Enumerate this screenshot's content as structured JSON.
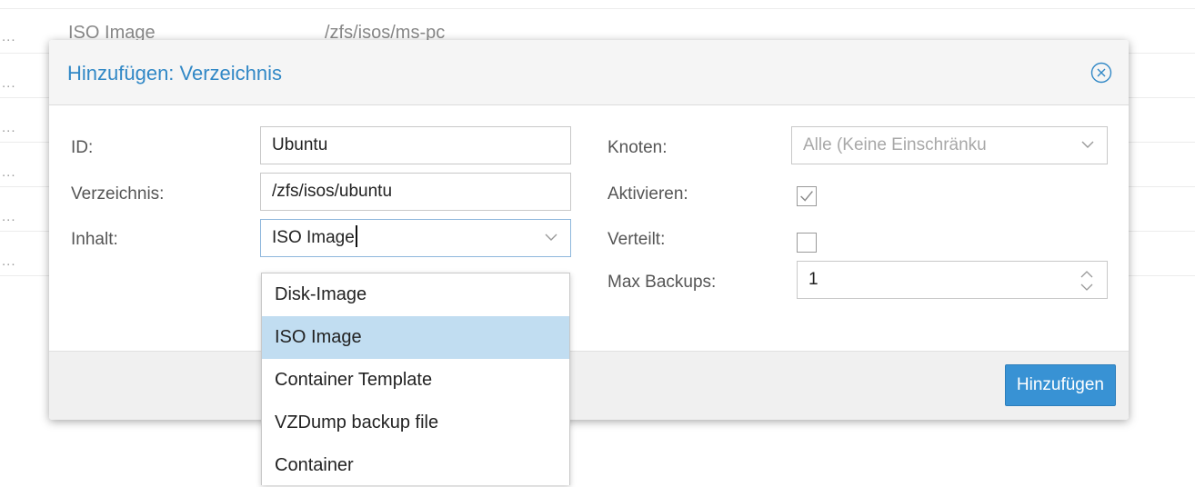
{
  "background": {
    "dots": "...",
    "visible_row": {
      "content": "ISO Image",
      "path": "/zfs/isos/ms-pc"
    }
  },
  "dialog": {
    "title": "Hinzufügen: Verzeichnis",
    "close_icon": "circle-x-icon",
    "fields": {
      "id": {
        "label": "ID:",
        "value": "Ubuntu"
      },
      "directory": {
        "label": "Verzeichnis:",
        "value": "/zfs/isos/ubuntu"
      },
      "content": {
        "label": "Inhalt:",
        "value": "ISO Image"
      },
      "nodes": {
        "label": "Knoten:",
        "placeholder": "Alle (Keine Einschränku"
      },
      "enable": {
        "label": "Aktivieren:",
        "checked": true
      },
      "shared": {
        "label": "Verteilt:",
        "checked": false
      },
      "max_backups": {
        "label": "Max Backups:",
        "value": "1"
      }
    },
    "submit_label": "Hinzufügen"
  },
  "content_dropdown": {
    "options": [
      "Disk-Image",
      "ISO Image",
      "Container Template",
      "VZDump backup file",
      "Container"
    ],
    "selected": "ISO Image"
  },
  "colors": {
    "accent": "#3188c6",
    "button": "#3892d4",
    "selected_item": "#c1ddf1"
  }
}
